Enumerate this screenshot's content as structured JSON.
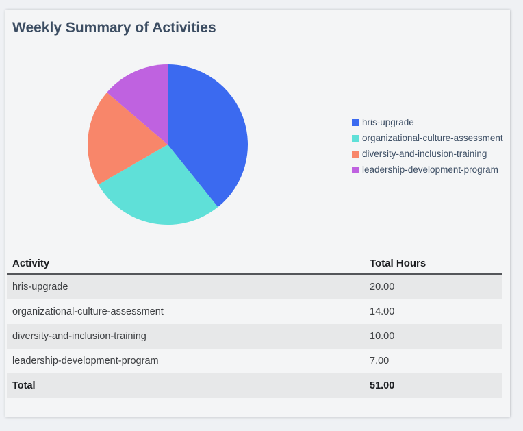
{
  "card": {
    "title": "Weekly Summary of Activities"
  },
  "chart_data": {
    "type": "pie",
    "title": "",
    "labels": [
      "hris-upgrade",
      "organizational-culture-assessment",
      "diversity-and-inclusion-training",
      "leadership-development-program"
    ],
    "values": [
      20,
      14,
      10,
      7
    ],
    "colors": [
      "#3b6af0",
      "#5fe0d8",
      "#f8866a",
      "#bf62e0"
    ],
    "start_angle_deg": 0,
    "direction": "clockwise",
    "legend_position": "right"
  },
  "table": {
    "columns": [
      "Activity",
      "Total Hours"
    ],
    "rows": [
      {
        "activity": "hris-upgrade",
        "hours": "20.00"
      },
      {
        "activity": "organizational-culture-assessment",
        "hours": "14.00"
      },
      {
        "activity": "diversity-and-inclusion-training",
        "hours": "10.00"
      },
      {
        "activity": "leadership-development-program",
        "hours": "7.00"
      }
    ],
    "total_row": {
      "label": "Total",
      "hours": "51.00"
    }
  },
  "theme": {
    "page_bg": "#eff1f4",
    "card_bg": "#f4f5f6",
    "title_color": "#3c4d62",
    "legend_text_color": "#3f5066",
    "header_text_color": "#1b1d20",
    "cell_text_color": "#3d3f42",
    "stripe_color": "#e7e8e9",
    "header_rule_color": "#54565a"
  }
}
